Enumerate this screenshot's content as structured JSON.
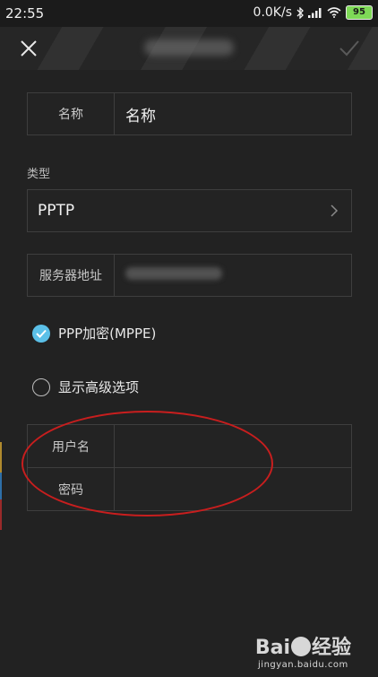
{
  "status_bar": {
    "time": "22:55",
    "network_speed": "0.0K/s",
    "battery": "95"
  },
  "header": {
    "close_icon": "close-icon",
    "confirm_icon": "check-icon"
  },
  "form": {
    "name": {
      "label": "名称",
      "value": "名称"
    },
    "type": {
      "section_label": "类型",
      "value": "PPTP",
      "chevron_icon": "chevron-right-icon"
    },
    "server": {
      "label": "服务器地址"
    },
    "ppp_encryption": {
      "label": "PPP加密(MPPE)",
      "checked": true
    },
    "advanced_options": {
      "label": "显示高级选项",
      "checked": false
    },
    "username": {
      "label": "用户名",
      "value": ""
    },
    "password": {
      "label": "密码",
      "value": ""
    }
  },
  "annotation_color": "#c81e1e",
  "accent_color": "#5bc0e8",
  "watermark": {
    "logo": "Bai 经验",
    "logo_left": "Bai",
    "logo_right": "经验",
    "url": "jingyan.baidu.com"
  }
}
